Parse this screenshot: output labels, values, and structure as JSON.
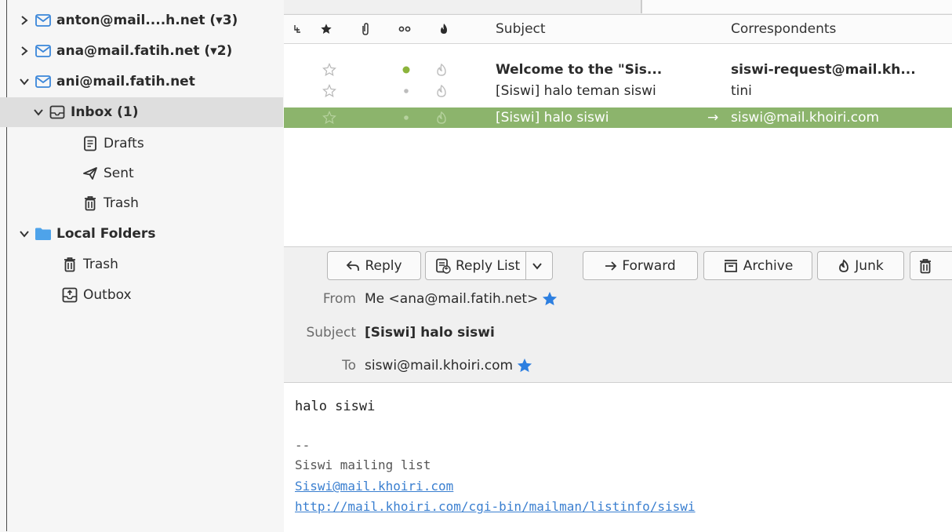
{
  "folders": {
    "accounts": [
      {
        "label": "anton@mail....h.net (▾3)",
        "expanded": false
      },
      {
        "label": "ana@mail.fatih.net (▾2)",
        "expanded": false
      },
      {
        "label": "ani@mail.fatih.net",
        "expanded": true
      }
    ],
    "ani_folders": [
      {
        "label": "Inbox (1)",
        "icon": "inbox-icon",
        "selected": true
      },
      {
        "label": "Drafts",
        "icon": "drafts-icon"
      },
      {
        "label": "Sent",
        "icon": "sent-icon"
      },
      {
        "label": "Trash",
        "icon": "trash-icon"
      }
    ],
    "local_folders": {
      "label": "Local Folders",
      "children": [
        {
          "label": "Trash",
          "icon": "trash-icon"
        },
        {
          "label": "Outbox",
          "icon": "outbox-icon"
        }
      ]
    }
  },
  "thread": {
    "columns": {
      "subject": "Subject",
      "correspondents": "Correspondents"
    },
    "rows": [
      {
        "subject": "Welcome to the \"Sis...",
        "correspondent": "siswi-request@mail.kh...",
        "unread": true,
        "status_color": "#8cb43c"
      },
      {
        "subject": "[Siswi] halo teman siswi",
        "correspondent": "tini",
        "unread": false
      },
      {
        "subject": "[Siswi] halo siswi",
        "correspondent": "siswi@mail.khoiri.com",
        "unread": false,
        "selected": true,
        "outgoing_arrow": "→"
      }
    ],
    "selected_color": "#8cb46c"
  },
  "header": {
    "buttons": {
      "reply": "Reply",
      "reply_list": "Reply List",
      "forward": "Forward",
      "archive": "Archive",
      "junk": "Junk"
    },
    "labels": {
      "from": "From",
      "subject": "Subject",
      "to": "To"
    },
    "from": "Me <ana@mail.fatih.net>",
    "subject": "[Siswi] halo siswi",
    "to": "siswi@mail.khoiri.com",
    "star_color": "#2d7fe0"
  },
  "body": {
    "text": "halo siswi",
    "separator": "--",
    "footer": "Siswi mailing list",
    "link1": "Siswi@mail.khoiri.com",
    "link2": "http://mail.khoiri.com/cgi-bin/mailman/listinfo/siswi"
  }
}
